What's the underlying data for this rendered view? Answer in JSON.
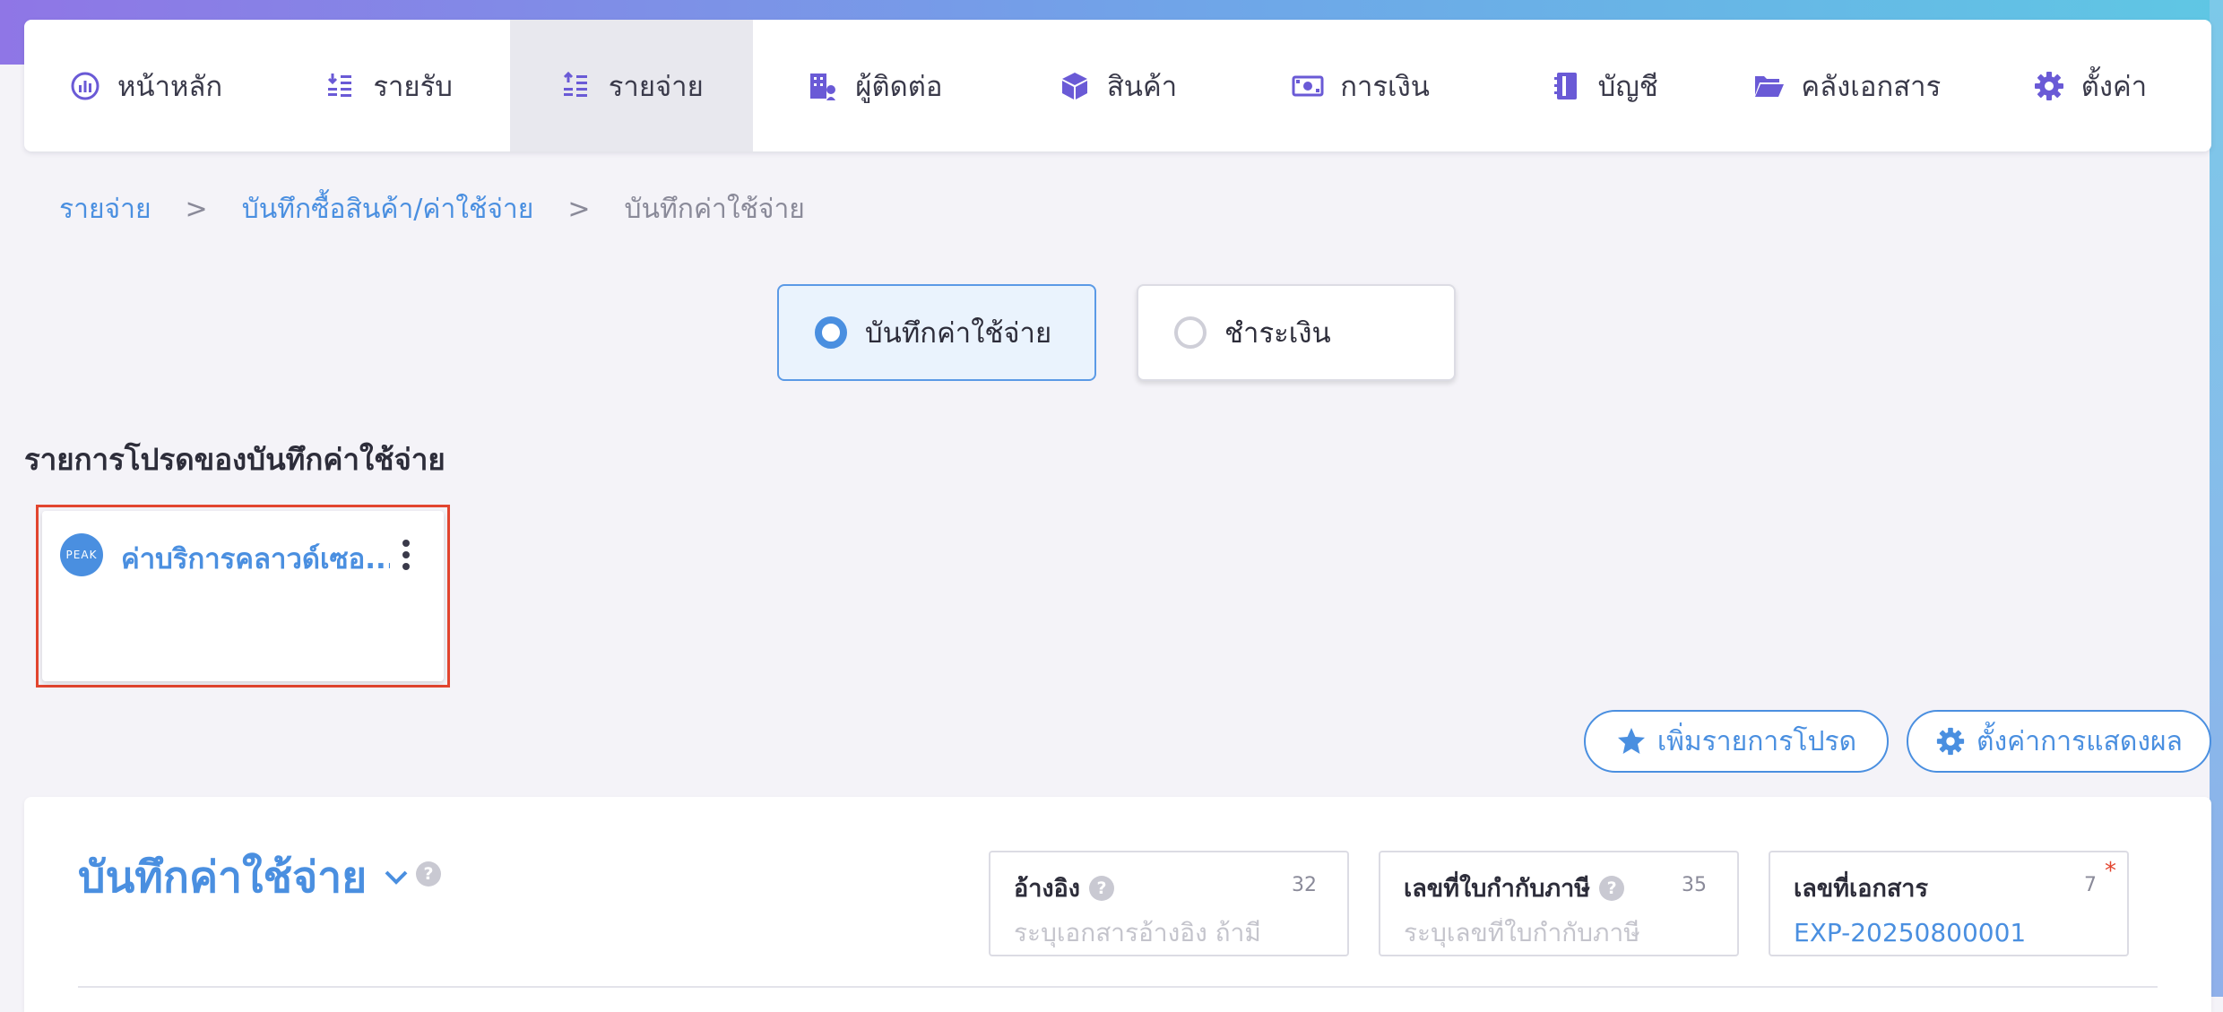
{
  "nav": {
    "items": [
      {
        "label": "หน้าหลัก",
        "icon": "dashboard-gauge-icon"
      },
      {
        "label": "รายรับ",
        "icon": "income-coins-icon"
      },
      {
        "label": "รายจ่าย",
        "icon": "expense-coins-icon",
        "active": true
      },
      {
        "label": "ผู้ติดต่อ",
        "icon": "contacts-building-icon"
      },
      {
        "label": "สินค้า",
        "icon": "product-box-icon"
      },
      {
        "label": "การเงิน",
        "icon": "money-banknote-icon"
      },
      {
        "label": "บัญชี",
        "icon": "accounting-book-icon"
      },
      {
        "label": "คลังเอกสาร",
        "icon": "folder-open-icon"
      },
      {
        "label": "ตั้งค่า",
        "icon": "gear-icon"
      }
    ]
  },
  "breadcrumb": {
    "items": [
      "รายจ่าย",
      "บันทึกซื้อสินค้า/ค่าใช้จ่าย"
    ],
    "separator": ">",
    "current": "บันทึกค่าใช้จ่าย"
  },
  "mode": {
    "options": [
      {
        "label": "บันทึกค่าใช้จ่าย",
        "selected": true
      },
      {
        "label": "ชำระเงิน",
        "selected": false
      }
    ]
  },
  "favorites": {
    "heading": "รายการโปรดของบันทึกค่าใช้จ่าย",
    "items": [
      {
        "title": "ค่าบริการคลาวด์เซอ...",
        "logo_text": "PEAK"
      }
    ]
  },
  "actions": {
    "add_favorite": "เพิ่มรายการโปรด",
    "display_settings": "ตั้งค่าการแสดงผล"
  },
  "form": {
    "title": "บันทึกค่าใช้จ่าย",
    "help": "?",
    "fields": [
      {
        "label": "อ้างอิง",
        "count": "32",
        "placeholder": "ระบุเอกสารอ้างอิง ถ้ามี",
        "value": ""
      },
      {
        "label": "เลขที่ใบกำกับภาษี",
        "count": "35",
        "placeholder": "ระบุเลขที่ใบกำกับภาษี",
        "value": ""
      },
      {
        "label": "เลขที่เอกสาร",
        "count": "7",
        "placeholder": "",
        "value": "EXP-20250800001",
        "required_mark": "*"
      }
    ]
  },
  "colors": {
    "accent": "#4a8fe0",
    "highlight_outline": "#e2452f",
    "active_nav": "#e8e8ee"
  }
}
